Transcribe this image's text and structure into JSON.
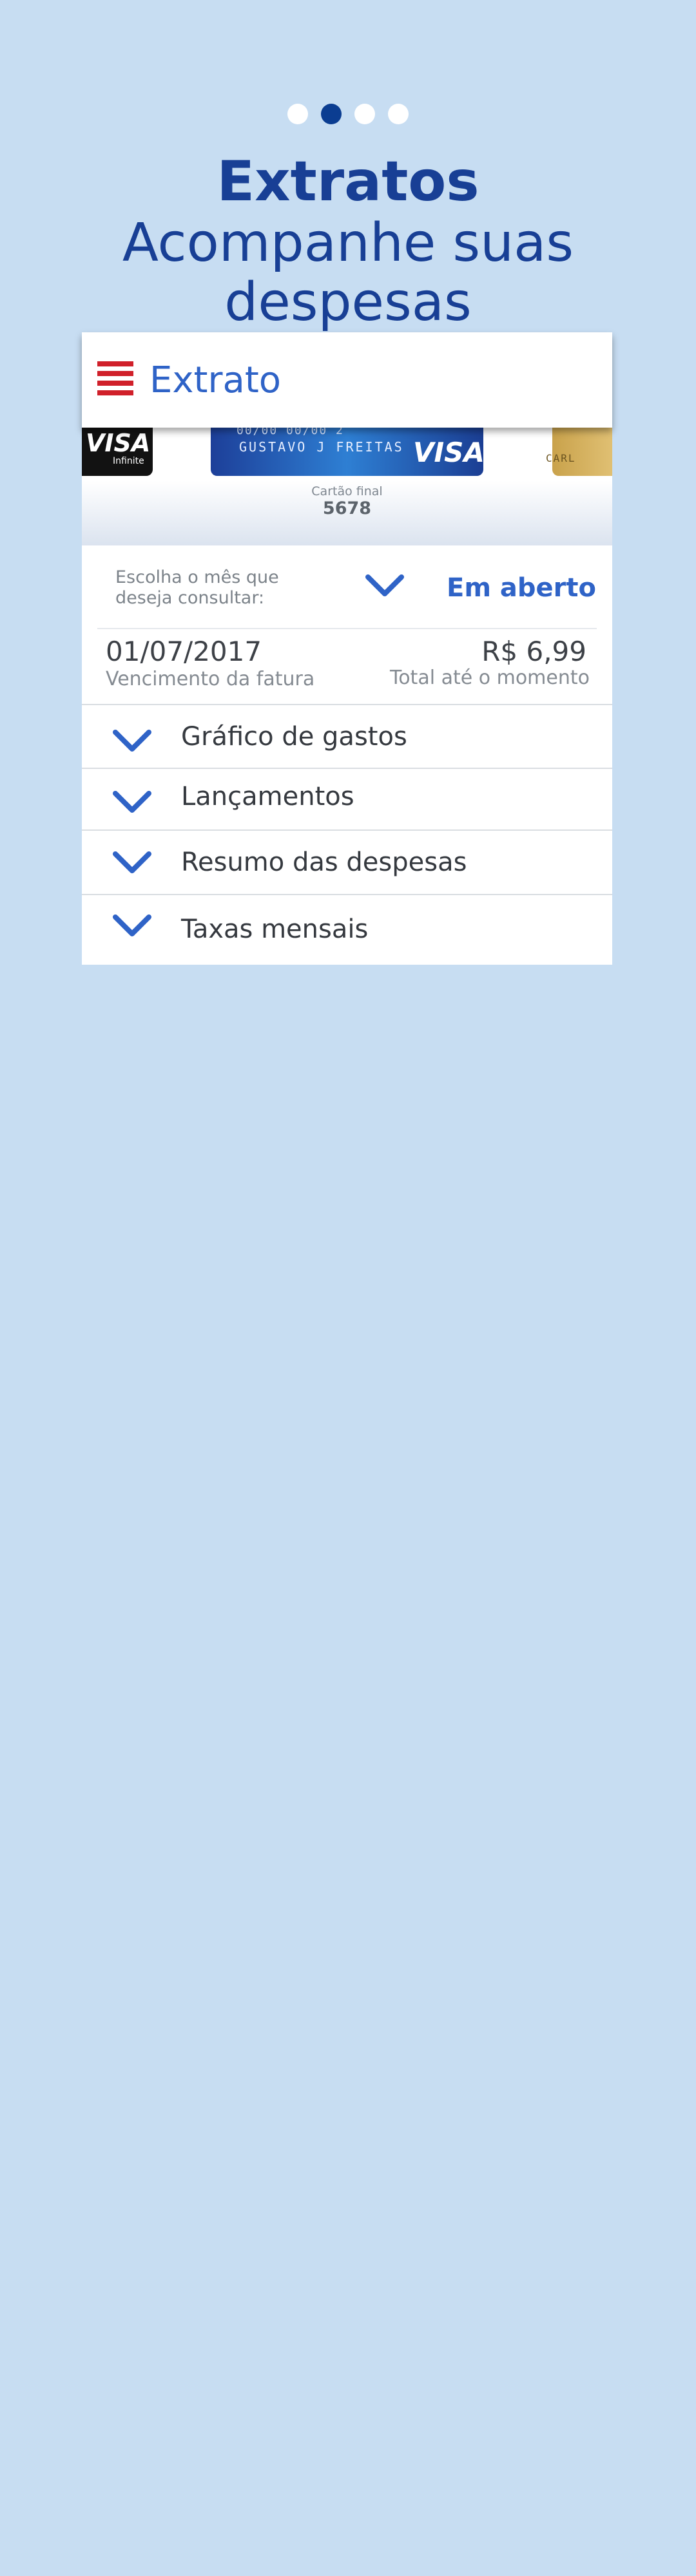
{
  "pagination": {
    "total": 4,
    "active_index": 1
  },
  "hero": {
    "title": "Extratos",
    "subtitle_line1": "Acompanhe suas",
    "subtitle_line2": "despesas"
  },
  "appbar": {
    "title": "Extrato",
    "menu_icon": "hamburger-menu-icon",
    "menu_color": "#d0202a"
  },
  "cards": {
    "left_brand": "VISA",
    "left_tier": "Infinite",
    "center_number": "00/00  00/00 2",
    "center_holder": "GUSTAVO J FREITAS",
    "center_brand": "VISA",
    "right_holder": "CARL",
    "caption": "Cartão final",
    "last_digits": "5678"
  },
  "month_selector": {
    "label": "Escolha o mês que deseja consultar:",
    "value": "Em aberto"
  },
  "invoice": {
    "due_date": "01/07/2017",
    "due_label": "Vencimento da fatura",
    "amount": "R$ 6,99",
    "amount_label": "Total até o momento"
  },
  "sections": [
    {
      "label": "Gráfico de gastos"
    },
    {
      "label": "Lançamentos"
    },
    {
      "label": "Resumo das despesas"
    },
    {
      "label": "Taxas mensais"
    }
  ],
  "colors": {
    "background": "#c7ddf2",
    "primary": "#183f95",
    "accent": "#2f63c7"
  }
}
